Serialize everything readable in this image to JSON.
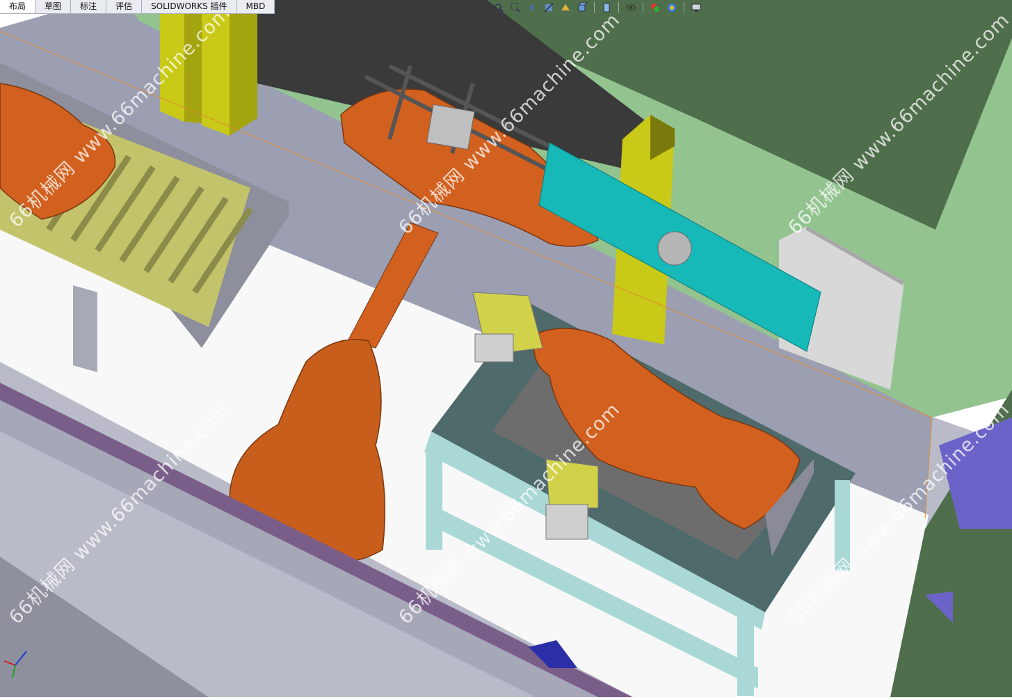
{
  "tabs": [
    {
      "label": "布局"
    },
    {
      "label": "草图"
    },
    {
      "label": "标注"
    },
    {
      "label": "评估"
    },
    {
      "label": "SOLIDWORKS 插件"
    },
    {
      "label": "MBD"
    }
  ],
  "toolbar": {
    "icons": [
      "zoom-to-fit-icon",
      "zoom-area-icon",
      "previous-view-icon",
      "section-view-icon",
      "dynamic-annotation-icon",
      "view-orientation-icon",
      "display-style-icon",
      "hide-show-items-icon",
      "edit-appearance-icon",
      "apply-scene-icon",
      "view-settings-icon"
    ]
  },
  "watermark": {
    "text": "66机械网 www.66machine.com"
  },
  "colors": {
    "robot_orange": "#d2611f",
    "floor_grey": "#999bb0",
    "wall_green": "#92c38f",
    "dark_green": "#4d6b4a",
    "pillar_yellow": "#c8c815",
    "panel_cyan": "#17b8b8",
    "table_top": "#4e6a6a"
  }
}
